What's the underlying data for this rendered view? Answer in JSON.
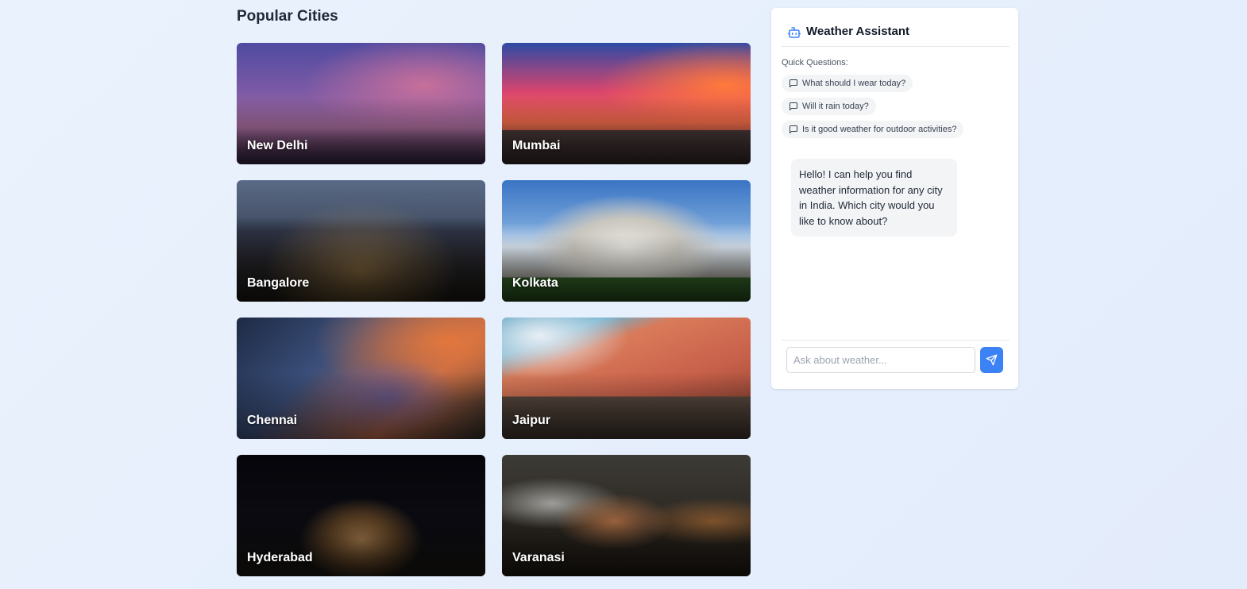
{
  "section": {
    "title": "Popular Cities"
  },
  "cities": [
    {
      "name": "New Delhi"
    },
    {
      "name": "Mumbai"
    },
    {
      "name": "Bangalore"
    },
    {
      "name": "Kolkata"
    },
    {
      "name": "Chennai"
    },
    {
      "name": "Jaipur"
    },
    {
      "name": "Hyderabad"
    },
    {
      "name": "Varanasi"
    }
  ],
  "assistant": {
    "title": "Weather Assistant",
    "quick_label": "Quick Questions:",
    "quick_questions": [
      "What should I wear today?",
      "Will it rain today?",
      "Is it good weather for outdoor activities?"
    ],
    "greeting": "Hello! I can help you find weather information for any city in India. Which city would you like to know about?",
    "input_placeholder": "Ask about weather...",
    "accent_color": "#3b82f6"
  },
  "icons": {
    "header": "bot-icon",
    "chip": "message-square-icon",
    "send": "send-icon"
  }
}
